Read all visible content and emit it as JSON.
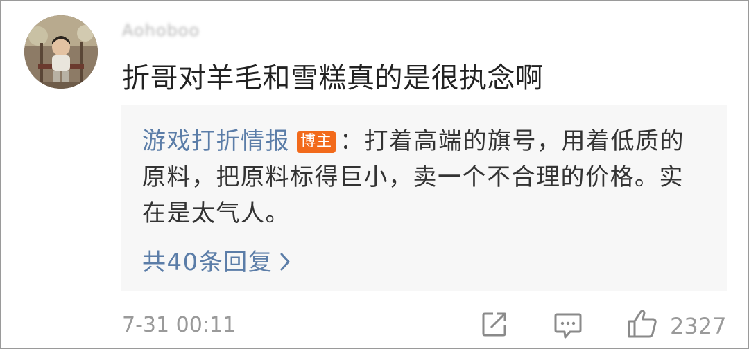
{
  "comment": {
    "username": "Aohoboo",
    "text": "折哥对羊毛和雪糕真的是很执念啊",
    "timestamp": "7-31 00:11",
    "like_count": "2327"
  },
  "reply": {
    "author": "游戏打折情报",
    "badge": "博主",
    "text": "：打着高端的旗号，用着低质的原料，把原料标得巨小，卖一个不合理的价格。实在是太气人。",
    "more_replies": "共40条回复"
  },
  "icons": {
    "avatar": "user-avatar-photo",
    "more": "chevron-right-icon",
    "forward": "share-icon",
    "comment": "comment-icon",
    "like": "thumbs-up-icon"
  },
  "colors": {
    "link": "#5b7da8",
    "badge": "#f26a1b",
    "reply_bg": "#f7f7f7",
    "meta": "#9a9a9a"
  }
}
